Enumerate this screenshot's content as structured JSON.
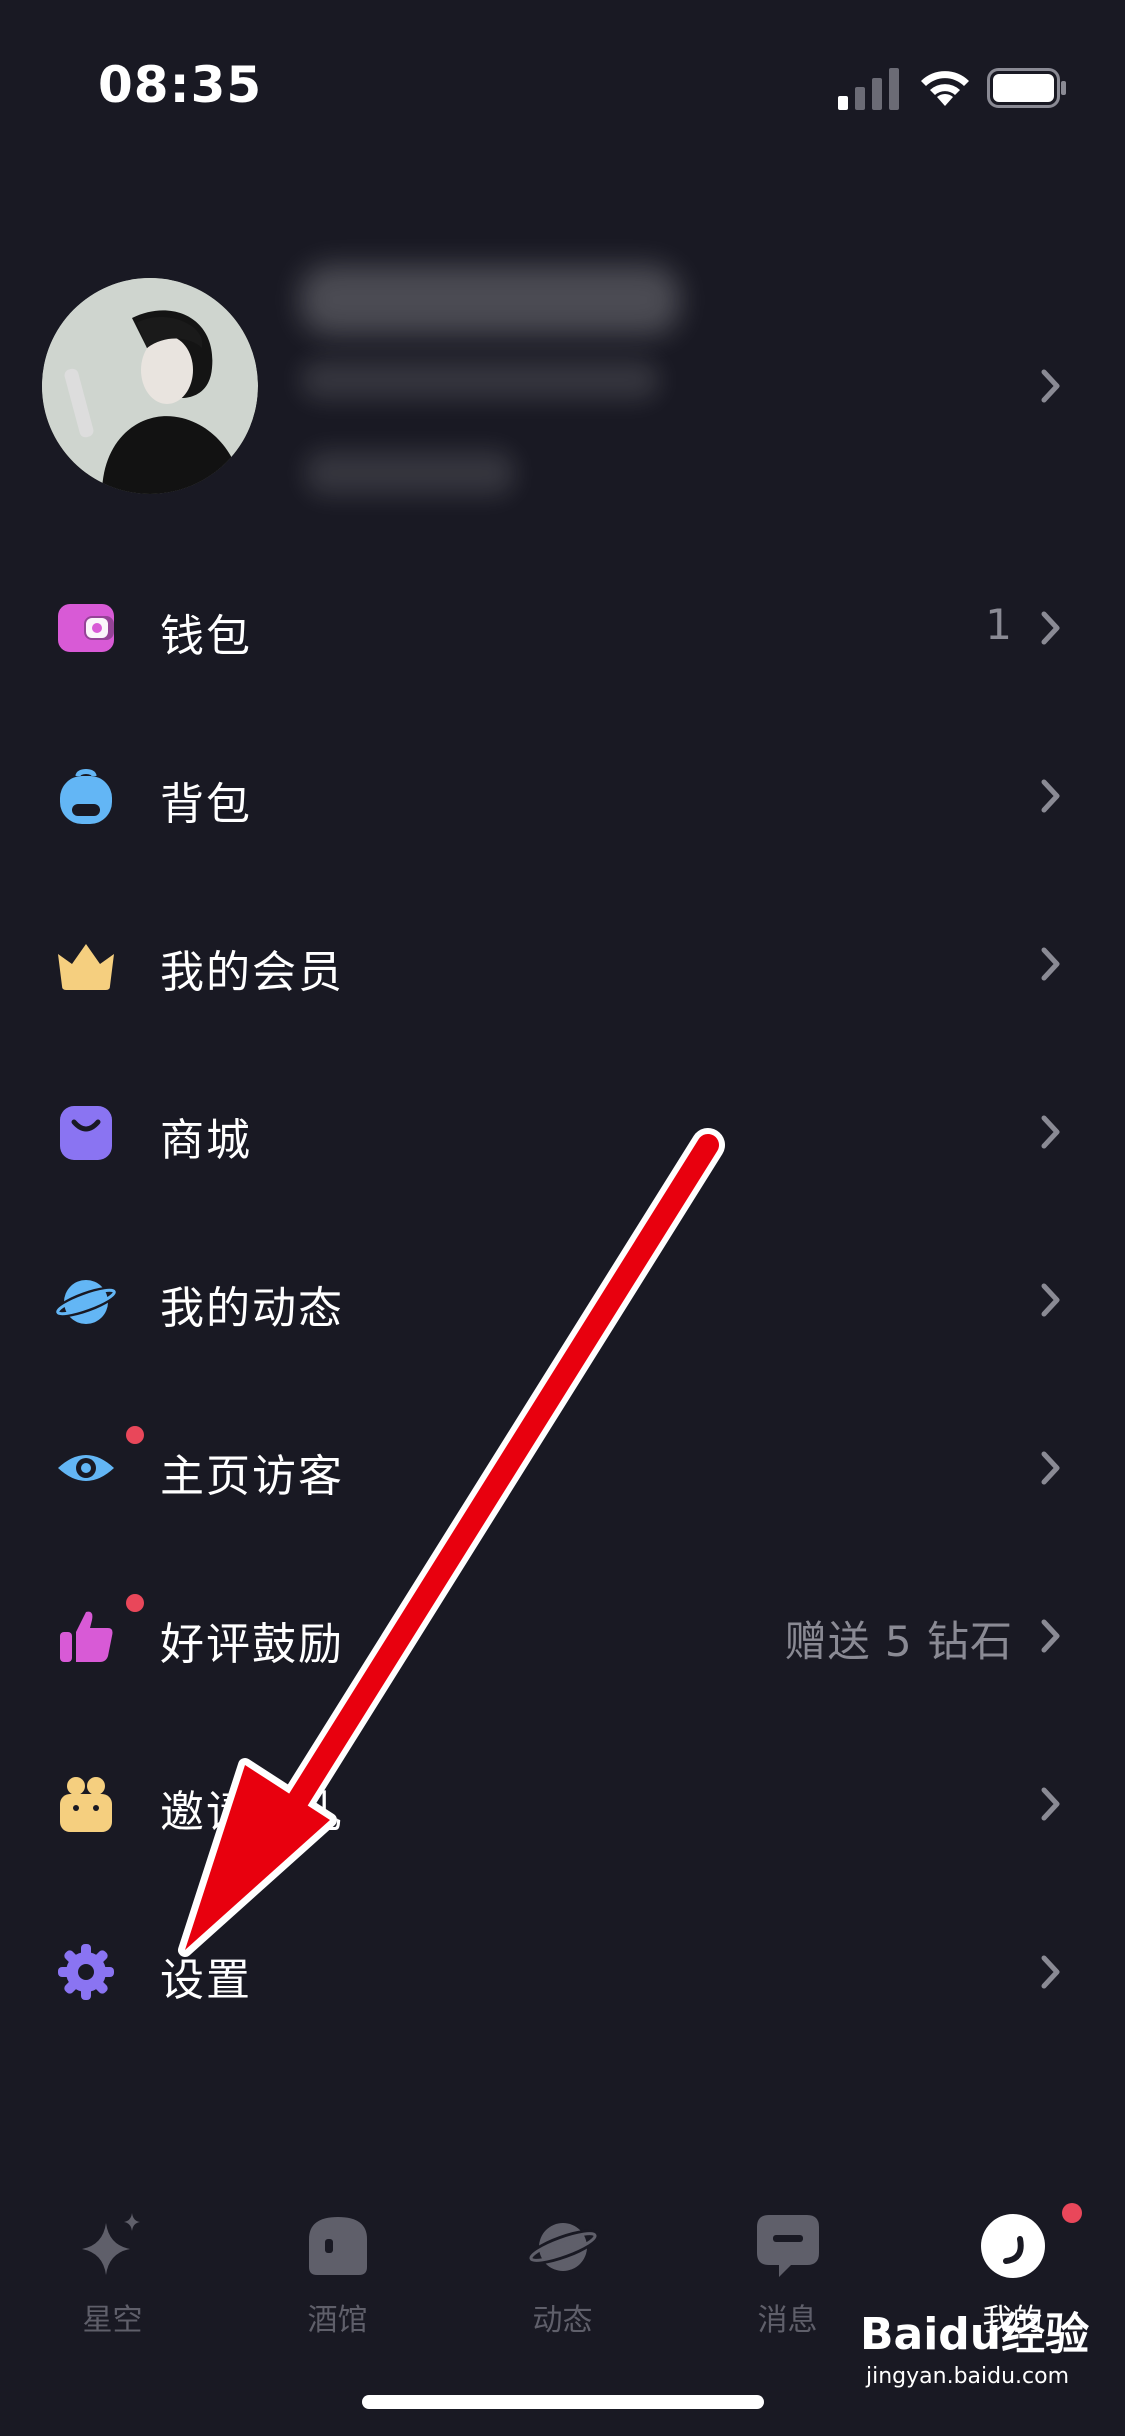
{
  "status": {
    "time": "08:35"
  },
  "menu": {
    "items": [
      {
        "label": "钱包",
        "value": "1",
        "icon": "wallet-icon",
        "color": "#d85ad6",
        "dot": false
      },
      {
        "label": "背包",
        "value": "",
        "icon": "backpack-icon",
        "color": "#63b6f5",
        "dot": false
      },
      {
        "label": "我的会员",
        "value": "",
        "icon": "crown-icon",
        "color": "#f5cf7f",
        "dot": false
      },
      {
        "label": "商城",
        "value": "",
        "icon": "shopping-bag-icon",
        "color": "#8a74f2",
        "dot": false
      },
      {
        "label": "我的动态",
        "value": "",
        "icon": "planet-icon",
        "color": "#63b6f5",
        "dot": false
      },
      {
        "label": "主页访客",
        "value": "",
        "icon": "eye-icon",
        "color": "#63b6f5",
        "dot": true
      },
      {
        "label": "好评鼓励",
        "value": "赠送 5 钻石",
        "icon": "thumbs-up-icon",
        "color": "#d85ad6",
        "dot": true
      },
      {
        "label": "邀请有礼",
        "value": "",
        "icon": "gift-icon",
        "color": "#f5cf7f",
        "dot": false
      },
      {
        "label": "设置",
        "value": "",
        "icon": "gear-icon",
        "color": "#8a74f2",
        "dot": false
      }
    ]
  },
  "tabbar": {
    "tabs": [
      {
        "label": "星空",
        "icon": "sparkle-icon",
        "active": false
      },
      {
        "label": "酒馆",
        "icon": "tavern-icon",
        "active": false
      },
      {
        "label": "动态",
        "icon": "planet-icon",
        "active": false
      },
      {
        "label": "消息",
        "icon": "message-icon",
        "active": false
      },
      {
        "label": "我的",
        "icon": "profile-icon",
        "active": true
      }
    ]
  },
  "watermark": {
    "logo": "Baidu经验",
    "url": "jingyan.baidu.com"
  },
  "colors": {
    "background": "#191923",
    "arrow": "#e8000e",
    "dot": "#e9475a"
  }
}
